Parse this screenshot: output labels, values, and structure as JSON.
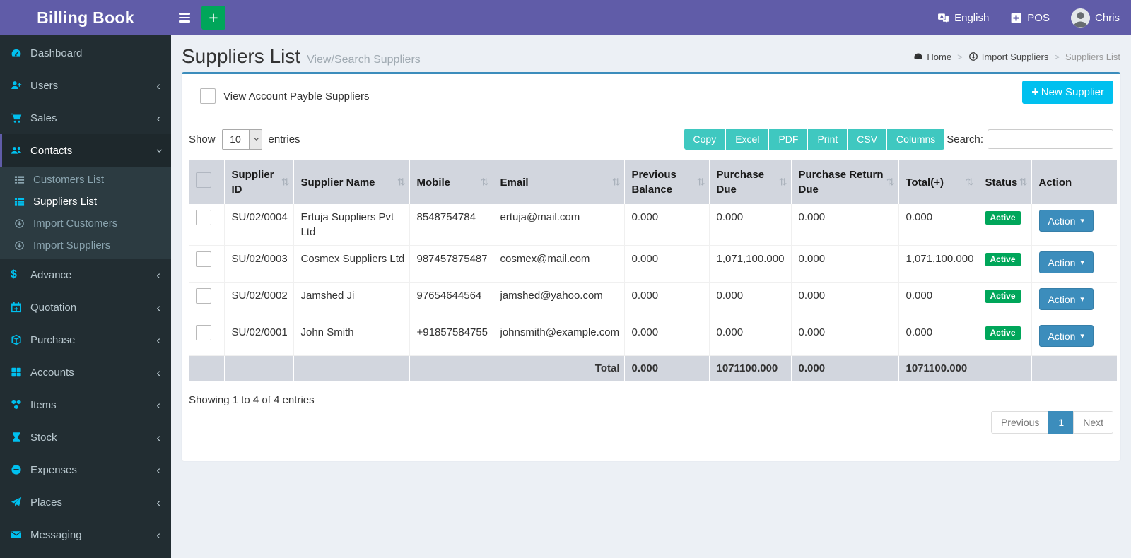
{
  "app": {
    "title": "Billing Book"
  },
  "topbar": {
    "language_label": "English",
    "pos_label": "POS",
    "user_name": "Chris"
  },
  "sidebar": {
    "items": [
      {
        "label": "Dashboard",
        "icon": "dashboard-icon",
        "expandable": false,
        "active": false
      },
      {
        "label": "Users",
        "icon": "user-plus-icon",
        "expandable": true,
        "active": false
      },
      {
        "label": "Sales",
        "icon": "cart-icon",
        "expandable": true,
        "active": false
      },
      {
        "label": "Contacts",
        "icon": "users-icon",
        "expandable": true,
        "active": true,
        "expanded": true,
        "children": [
          {
            "label": "Customers List",
            "icon": "list-icon",
            "active": false
          },
          {
            "label": "Suppliers List",
            "icon": "list-icon",
            "active": true
          },
          {
            "label": "Import Customers",
            "icon": "arrow-circle-icon",
            "active": false
          },
          {
            "label": "Import Suppliers",
            "icon": "arrow-circle-icon",
            "active": false
          }
        ]
      },
      {
        "label": "Advance",
        "icon": "dollar-icon",
        "expandable": true,
        "active": false
      },
      {
        "label": "Quotation",
        "icon": "calendar-plus-icon",
        "expandable": true,
        "active": false
      },
      {
        "label": "Purchase",
        "icon": "cube-icon",
        "expandable": true,
        "active": false
      },
      {
        "label": "Accounts",
        "icon": "grid-icon",
        "expandable": true,
        "active": false
      },
      {
        "label": "Items",
        "icon": "cubes-icon",
        "expandable": true,
        "active": false
      },
      {
        "label": "Stock",
        "icon": "hourglass-icon",
        "expandable": true,
        "active": false
      },
      {
        "label": "Expenses",
        "icon": "minus-circle-icon",
        "expandable": true,
        "active": false
      },
      {
        "label": "Places",
        "icon": "paper-plane-icon",
        "expandable": true,
        "active": false
      },
      {
        "label": "Messaging",
        "icon": "envelope-icon",
        "expandable": true,
        "active": false
      }
    ]
  },
  "page": {
    "title": "Suppliers List",
    "subtitle": "View/Search Suppliers",
    "breadcrumb": [
      {
        "label": "Home",
        "icon": "dashboard-icon"
      },
      {
        "label": "Import Suppliers",
        "icon": "arrow-circle-icon"
      },
      {
        "label": "Suppliers List"
      }
    ]
  },
  "card": {
    "filter_checkbox_label": "View Account Payble Suppliers",
    "filter_checkbox_checked": false,
    "new_supplier_label": "New Supplier",
    "show_label": "Show",
    "page_length": "10",
    "entries_label": "entries",
    "export_buttons": [
      "Copy",
      "Excel",
      "PDF",
      "Print",
      "CSV",
      "Columns"
    ],
    "search_label": "Search:",
    "search_value": "",
    "summary": "Showing 1 to 4 of 4 entries",
    "pagination": {
      "previous": "Previous",
      "pages": [
        "1"
      ],
      "current": "1",
      "next": "Next"
    }
  },
  "table": {
    "columns": [
      "Supplier ID",
      "Supplier Name",
      "Mobile",
      "Email",
      "Previous Balance",
      "Purchase Due",
      "Purchase Return Due",
      "Total(+)",
      "Status",
      "Action"
    ],
    "rows": [
      {
        "id": "SU/02/0004",
        "name": "Ertuja Suppliers Pvt Ltd",
        "mobile": "8548754784",
        "email": "ertuja@mail.com",
        "previous_balance": "0.000",
        "purchase_due": "0.000",
        "purchase_return_due": "0.000",
        "total": "0.000",
        "status": "Active",
        "action_label": "Action"
      },
      {
        "id": "SU/02/0003",
        "name": "Cosmex Suppliers Ltd",
        "mobile": "987457875487",
        "email": "cosmex@mail.com",
        "previous_balance": "0.000",
        "purchase_due": "1,071,100.000",
        "purchase_return_due": "0.000",
        "total": "1,071,100.000",
        "status": "Active",
        "action_label": "Action"
      },
      {
        "id": "SU/02/0002",
        "name": "Jamshed Ji",
        "mobile": "97654644564",
        "email": "jamshed@yahoo.com",
        "previous_balance": "0.000",
        "purchase_due": "0.000",
        "purchase_return_due": "0.000",
        "total": "0.000",
        "status": "Active",
        "action_label": "Action"
      },
      {
        "id": "SU/02/0001",
        "name": "John Smith",
        "mobile": "+91857584755",
        "email": "johnsmith@example.com",
        "previous_balance": "0.000",
        "purchase_due": "0.000",
        "purchase_return_due": "0.000",
        "total": "0.000",
        "status": "Active",
        "action_label": "Action"
      }
    ],
    "footer": {
      "label": "Total",
      "previous_balance": "0.000",
      "purchase_due": "1071100.000",
      "purchase_return_due": "0.000",
      "total": "1071100.000"
    }
  },
  "colors": {
    "header_purple": "#605ca8",
    "sidebar_dark": "#222d32",
    "icon_cyan": "#00c0ef",
    "green": "#00a65a",
    "info_cyan": "#00c0ef",
    "export_teal": "#3fc8c0",
    "primary_blue": "#3c8dbc",
    "table_header_gray": "#d2d6de",
    "content_bg": "#ecf0f5"
  }
}
